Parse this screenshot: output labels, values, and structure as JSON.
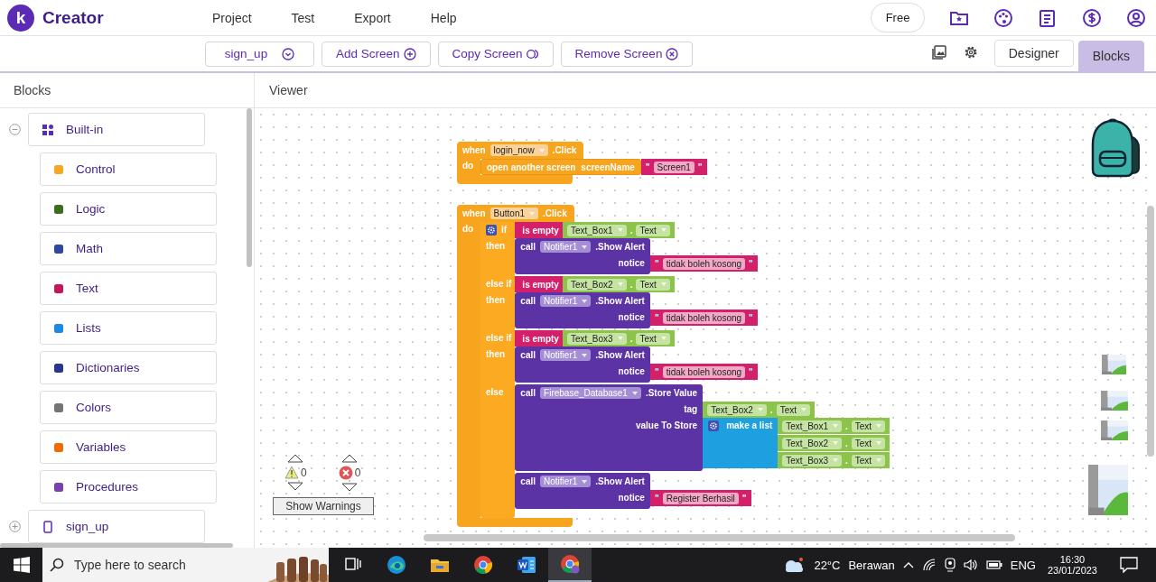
{
  "app": {
    "logo_mark": "k",
    "name": "Creator"
  },
  "menu": [
    "Project",
    "Test",
    "Export",
    "Help"
  ],
  "account": {
    "plan": "Free"
  },
  "toolbar": {
    "screen": "sign_up",
    "actions": [
      {
        "label": "Add Screen",
        "kind": "add"
      },
      {
        "label": "Copy Screen",
        "kind": "copy"
      },
      {
        "label": "Remove Screen",
        "kind": "remove"
      }
    ],
    "views": [
      {
        "label": "Designer",
        "selected": false
      },
      {
        "label": "Blocks",
        "selected": true
      }
    ]
  },
  "palette": {
    "title": "Blocks",
    "groups": [
      {
        "label": "Built-in",
        "expanded": true,
        "children": [
          {
            "label": "Control",
            "color": "#f5a623"
          },
          {
            "label": "Logic",
            "color": "#3c6e1f"
          },
          {
            "label": "Math",
            "color": "#2e4a9e"
          },
          {
            "label": "Text",
            "color": "#c2185b"
          },
          {
            "label": "Lists",
            "color": "#1e88e5"
          },
          {
            "label": "Dictionaries",
            "color": "#283593"
          },
          {
            "label": "Colors",
            "color": "#757575"
          },
          {
            "label": "Variables",
            "color": "#ef6c00"
          },
          {
            "label": "Procedures",
            "color": "#7b3fb0"
          }
        ]
      },
      {
        "label": "sign_up",
        "expanded": false
      }
    ]
  },
  "viewer": {
    "title": "Viewer",
    "workspace": [
      {
        "kind": "event",
        "when": "when",
        "component": "login_now",
        "event": ".Click",
        "do": "do",
        "body": [
          {
            "kind": "open_screen",
            "label": "open another screen",
            "param": "screenName",
            "arg": {
              "kind": "text",
              "quotes": [
                "\"",
                "\""
              ],
              "value": "Screen1"
            }
          }
        ]
      },
      {
        "kind": "event",
        "when": "when",
        "component": "Button1",
        "event": ".Click",
        "do": "do",
        "body": [
          {
            "kind": "if",
            "clauses": [
              {
                "label": "if",
                "test": {
                  "kind": "is_empty",
                  "label": "is empty",
                  "arg": {
                    "kind": "getter",
                    "component": "Text_Box1",
                    "dot": ".",
                    "property": "Text"
                  }
                }
              },
              {
                "label": "then",
                "body": [
                  {
                    "kind": "call",
                    "call": "call",
                    "component": "Notifier1",
                    "method": ".Show Alert",
                    "params": [
                      {
                        "name": "notice",
                        "arg": {
                          "kind": "text",
                          "quotes": [
                            "\"",
                            "\""
                          ],
                          "value": "tidak boleh kosong"
                        }
                      }
                    ]
                  }
                ]
              },
              {
                "label": "else if",
                "test": {
                  "kind": "is_empty",
                  "label": "is empty",
                  "arg": {
                    "kind": "getter",
                    "component": "Text_Box2",
                    "dot": ".",
                    "property": "Text"
                  }
                }
              },
              {
                "label": "then",
                "body": [
                  {
                    "kind": "call",
                    "call": "call",
                    "component": "Notifier1",
                    "method": ".Show Alert",
                    "params": [
                      {
                        "name": "notice",
                        "arg": {
                          "kind": "text",
                          "quotes": [
                            "\"",
                            "\""
                          ],
                          "value": "tidak boleh kosong"
                        }
                      }
                    ]
                  }
                ]
              },
              {
                "label": "else if",
                "test": {
                  "kind": "is_empty",
                  "label": "is empty",
                  "arg": {
                    "kind": "getter",
                    "component": "Text_Box3",
                    "dot": ".",
                    "property": "Text"
                  }
                }
              },
              {
                "label": "then",
                "body": [
                  {
                    "kind": "call",
                    "call": "call",
                    "component": "Notifier1",
                    "method": ".Show Alert",
                    "params": [
                      {
                        "name": "notice",
                        "arg": {
                          "kind": "text",
                          "quotes": [
                            "\"",
                            "\""
                          ],
                          "value": "tidak boleh kosong"
                        }
                      }
                    ]
                  }
                ]
              },
              {
                "label": "else",
                "body": [
                  {
                    "kind": "call",
                    "call": "call",
                    "component": "Firebase_Database1",
                    "method": ".Store Value",
                    "params": [
                      {
                        "name": "tag",
                        "arg": {
                          "kind": "getter",
                          "component": "Text_Box2",
                          "dot": ".",
                          "property": "Text"
                        }
                      },
                      {
                        "name": "value To Store",
                        "arg": {
                          "kind": "make_list",
                          "label": "make a list",
                          "items": [
                            {
                              "kind": "getter",
                              "component": "Text_Box1",
                              "dot": ".",
                              "property": "Text"
                            },
                            {
                              "kind": "getter",
                              "component": "Text_Box2",
                              "dot": ".",
                              "property": "Text"
                            },
                            {
                              "kind": "getter",
                              "component": "Text_Box3",
                              "dot": ".",
                              "property": "Text"
                            }
                          ]
                        }
                      }
                    ]
                  },
                  {
                    "kind": "call",
                    "call": "call",
                    "component": "Notifier1",
                    "method": ".Show Alert",
                    "params": [
                      {
                        "name": "notice",
                        "arg": {
                          "kind": "text",
                          "quotes": [
                            "\"",
                            "\""
                          ],
                          "value": "Register Berhasil"
                        }
                      }
                    ]
                  }
                ]
              }
            ]
          }
        ]
      }
    ],
    "warnings": {
      "warning_count": "0",
      "error_count": "0",
      "button": "Show Warnings"
    }
  },
  "taskbar": {
    "search_placeholder": "Type here to search",
    "apps": [
      {
        "kind": "taskview",
        "selected": false
      },
      {
        "kind": "edge",
        "selected": false
      },
      {
        "kind": "files",
        "selected": false
      },
      {
        "kind": "chrome",
        "selected": false
      },
      {
        "kind": "word",
        "selected": false
      },
      {
        "kind": "chrome_profile",
        "selected": true
      }
    ],
    "weather": {
      "temperature": "22°C",
      "condition": "Berawan"
    },
    "language": "ENG",
    "time": "16:30",
    "date": "23/01/2023"
  }
}
